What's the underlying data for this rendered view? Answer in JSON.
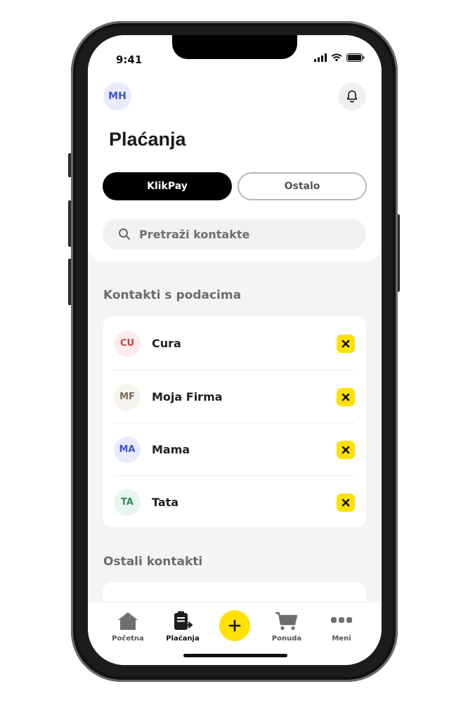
{
  "status": {
    "time": "9:41"
  },
  "header": {
    "avatar_initials": "MH",
    "title": "Plaćanja"
  },
  "segments": {
    "active": "KlikPay",
    "inactive": "Ostalo"
  },
  "search": {
    "placeholder": "Pretraži kontakte"
  },
  "sections": {
    "with_data": "Kontakti s podacima",
    "others": "Ostali kontakti"
  },
  "contacts": [
    {
      "initials": "CU",
      "name": "Cura",
      "color": "#c0463f",
      "bg": "#fdeceb"
    },
    {
      "initials": "MF",
      "name": "Moja Firma",
      "color": "#7a6a5e",
      "bg": "#f7f3ef"
    },
    {
      "initials": "MA",
      "name": "Mama",
      "color": "#3a56d8",
      "bg": "#e8ebfb"
    },
    {
      "initials": "TA",
      "name": "Tata",
      "color": "#2f8a5c",
      "bg": "#e9f6ef"
    }
  ],
  "tabbar": {
    "home": "Početna",
    "payments": "Plaćanja",
    "offer": "Ponuda",
    "menu": "Meni"
  },
  "colors": {
    "accent": "#ffe100",
    "dark": "#000000"
  }
}
